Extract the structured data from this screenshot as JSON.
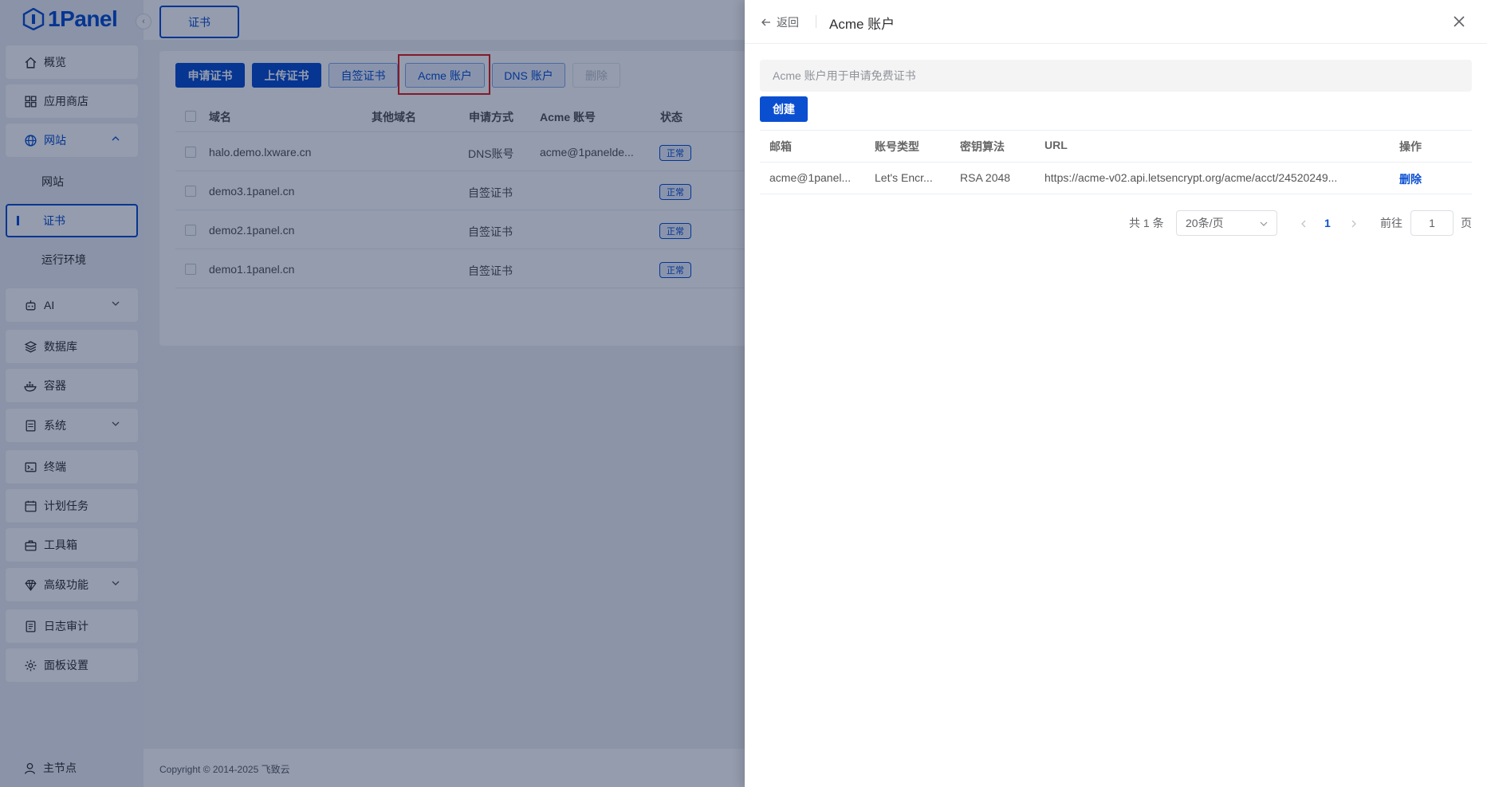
{
  "app": {
    "logo_text": "1Panel"
  },
  "sidebar": {
    "items": [
      {
        "label": "概览",
        "icon": "home-icon"
      },
      {
        "label": "应用商店",
        "icon": "grid-icon"
      },
      {
        "label": "网站",
        "icon": "globe-icon"
      },
      {
        "label": "网站"
      },
      {
        "label": "证书"
      },
      {
        "label": "运行环境"
      },
      {
        "label": "AI",
        "icon": "robot-icon"
      },
      {
        "label": "数据库",
        "icon": "layers-icon"
      },
      {
        "label": "容器",
        "icon": "docker-icon"
      },
      {
        "label": "系统",
        "icon": "server-icon"
      },
      {
        "label": "终端",
        "icon": "terminal-icon"
      },
      {
        "label": "计划任务",
        "icon": "calendar-icon"
      },
      {
        "label": "工具箱",
        "icon": "toolbox-icon"
      },
      {
        "label": "高级功能",
        "icon": "diamond-icon"
      },
      {
        "label": "日志审计",
        "icon": "log-icon"
      },
      {
        "label": "面板设置",
        "icon": "gear-icon"
      }
    ],
    "node_label": "主节点"
  },
  "tabs": {
    "active": "证书"
  },
  "toolbar": {
    "apply": "申请证书",
    "upload": "上传证书",
    "self_signed": "自签证书",
    "acme": "Acme 账户",
    "dns": "DNS 账户",
    "delete": "删除"
  },
  "table": {
    "headers": [
      "域名",
      "其他域名",
      "申请方式",
      "Acme 账号",
      "状态"
    ],
    "rows": [
      {
        "domain": "halo.demo.lxware.cn",
        "other": "",
        "method": "DNS账号",
        "acme": "acme@1panelde...",
        "status": "正常"
      },
      {
        "domain": "demo3.1panel.cn",
        "other": "",
        "method": "自签证书",
        "acme": "",
        "status": "正常"
      },
      {
        "domain": "demo2.1panel.cn",
        "other": "",
        "method": "自签证书",
        "acme": "",
        "status": "正常"
      },
      {
        "domain": "demo1.1panel.cn",
        "other": "",
        "method": "自签证书",
        "acme": "",
        "status": "正常"
      }
    ]
  },
  "footer": {
    "copyright": "Copyright © 2014-2025 飞致云"
  },
  "drawer": {
    "back": "返回",
    "title": "Acme 账户",
    "info": "Acme 账户用于申请免费证书",
    "create": "创建",
    "headers": [
      "邮箱",
      "账号类型",
      "密钥算法",
      "URL",
      "操作"
    ],
    "row": {
      "email": "acme@1panel...",
      "type": "Let's Encr...",
      "algorithm": "RSA 2048",
      "url": "https://acme-v02.api.letsencrypt.org/acme/acct/24520249...",
      "action": "删除"
    },
    "pagination": {
      "total": "共 1 条",
      "page_size": "20条/页",
      "current_page": "1",
      "goto_label": "前往",
      "goto_value": "1",
      "page_suffix": "页"
    }
  },
  "colors": {
    "primary": "#0b4fd1",
    "highlight": "#e02020"
  }
}
